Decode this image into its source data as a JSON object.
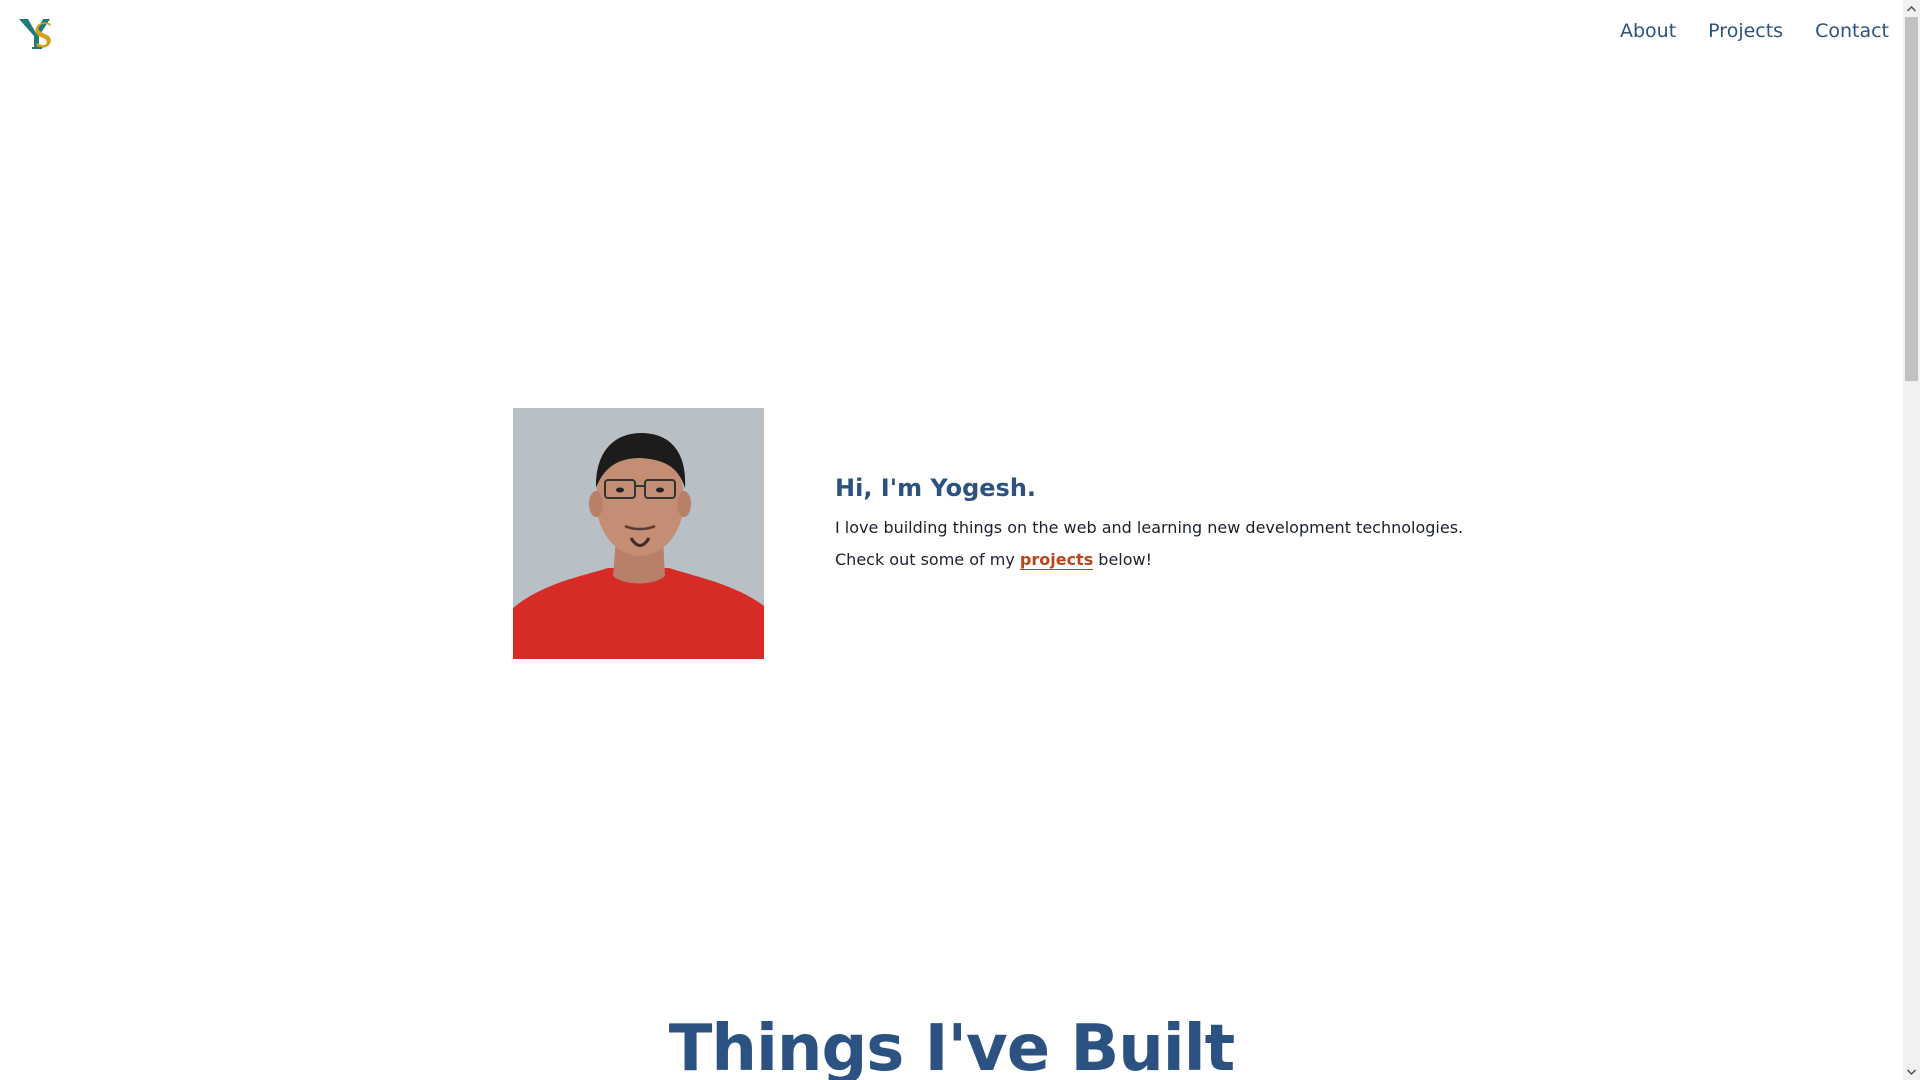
{
  "header": {
    "logo_alt": "YS",
    "nav": [
      {
        "label": "About"
      },
      {
        "label": "Projects"
      },
      {
        "label": "Contact"
      }
    ]
  },
  "hero": {
    "title": "Hi, I'm Yogesh.",
    "line1": "I love building things on the web and learning new development technologies.",
    "line2_before": "Check out some of my ",
    "line2_link": "projects",
    "line2_after": " below!"
  },
  "section": {
    "title": "Things I've Built"
  },
  "colors": {
    "accent": "#2c5282",
    "link": "#b7471b",
    "logo_teal": "#1f7a7a",
    "logo_gold": "#d4a017",
    "photo_bg": "#b9c0c5",
    "shirt": "#d62b26"
  },
  "icons": {
    "logo": "ys-monogram-logo",
    "scroll_up": "chevron-up-icon",
    "scroll_down": "chevron-down-icon"
  }
}
